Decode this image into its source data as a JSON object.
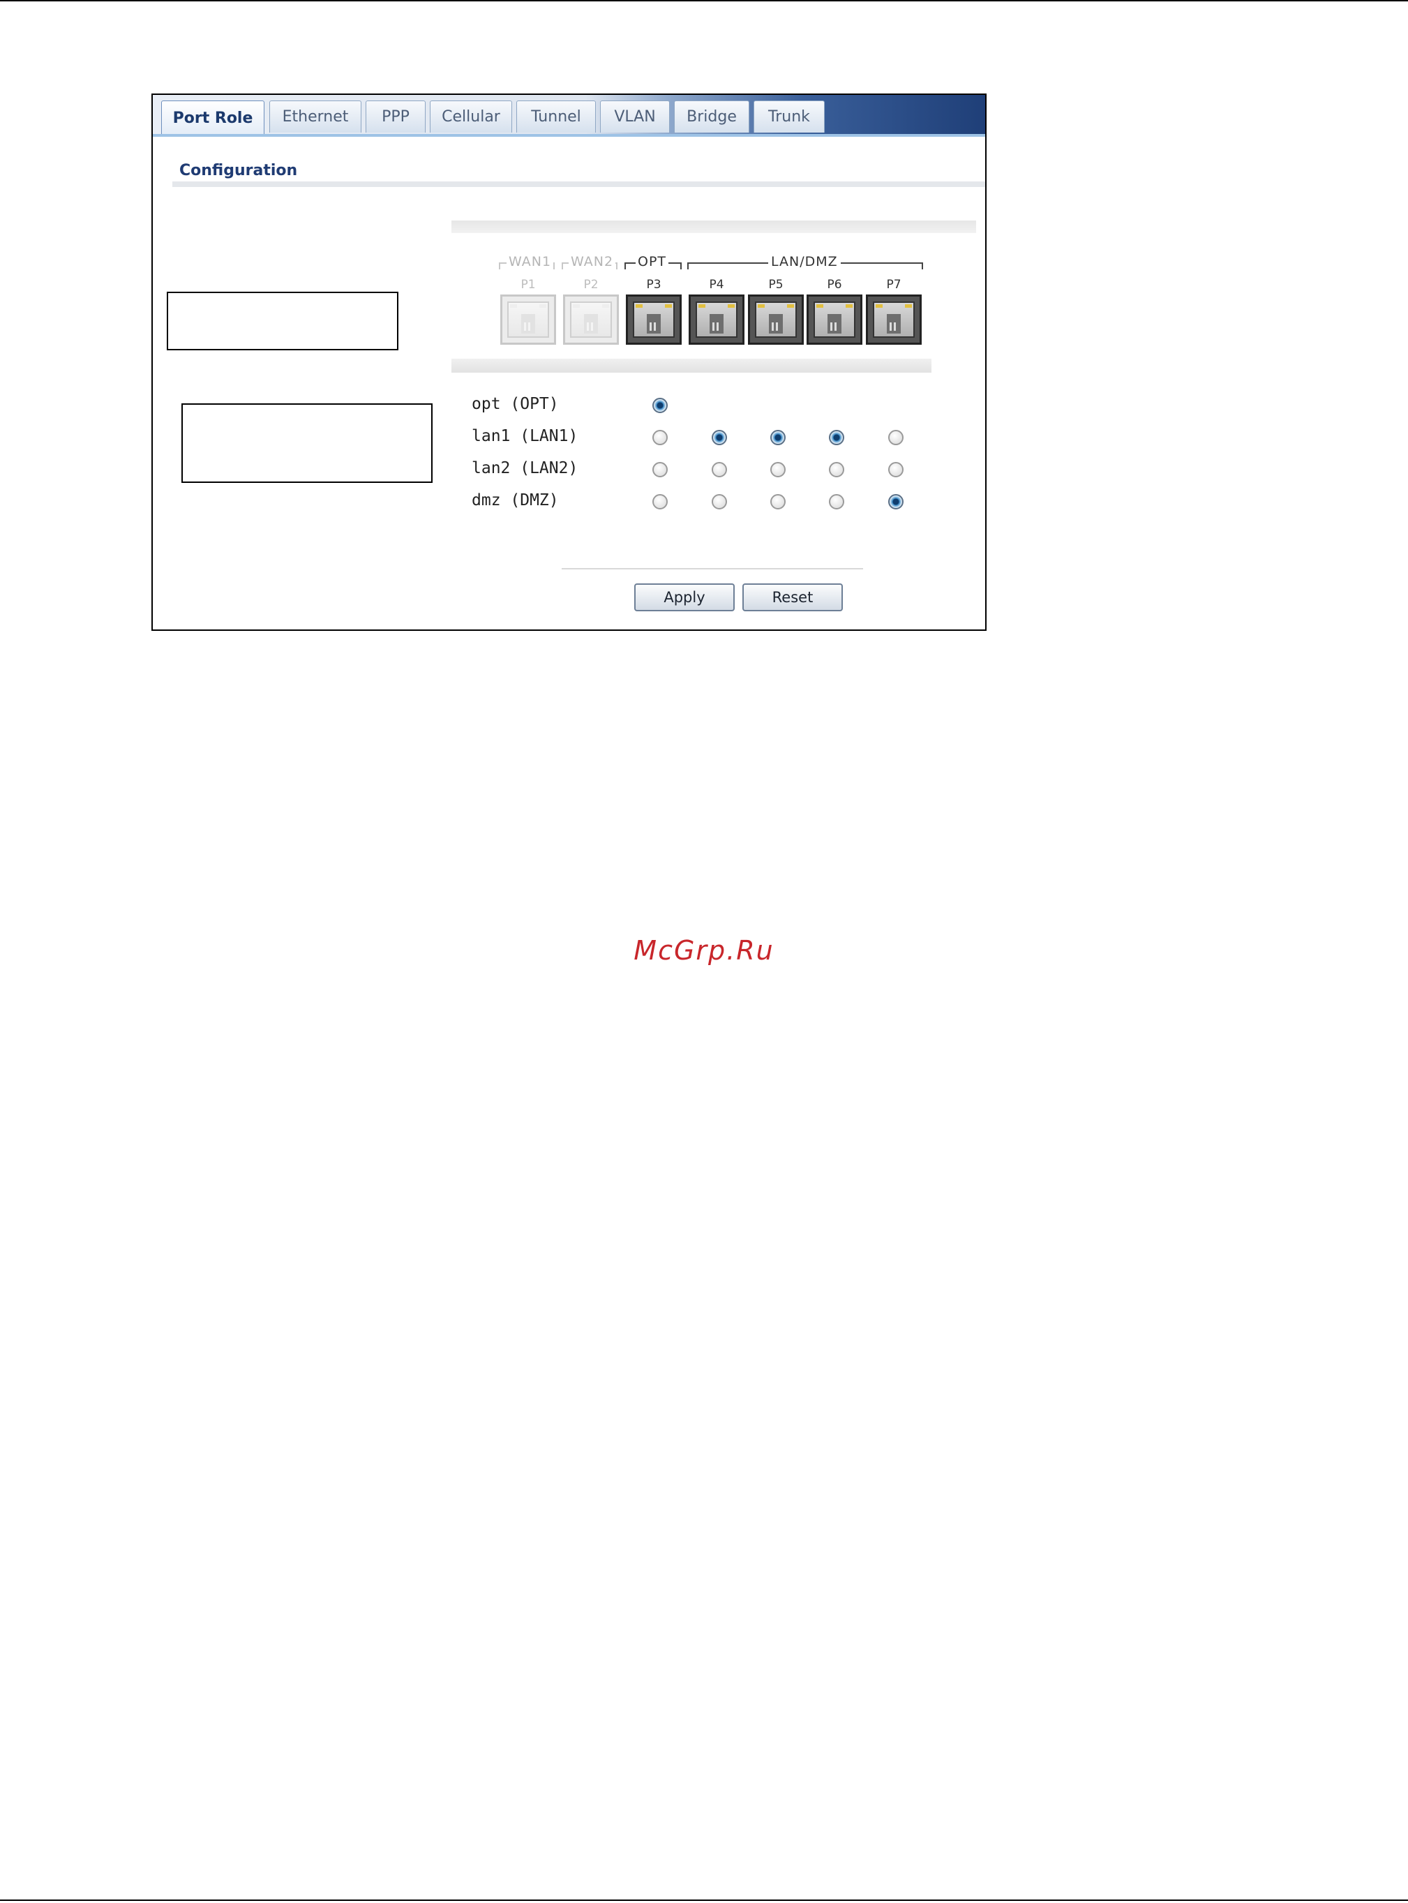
{
  "tabs": [
    {
      "label": "Port Role",
      "active": true
    },
    {
      "label": "Ethernet"
    },
    {
      "label": "PPP"
    },
    {
      "label": "Cellular"
    },
    {
      "label": "Tunnel"
    },
    {
      "label": "VLAN"
    },
    {
      "label": "Bridge"
    },
    {
      "label": "Trunk"
    }
  ],
  "section": {
    "title": "Configuration"
  },
  "port_groups": {
    "wan1": "WAN1",
    "wan2": "WAN2",
    "opt": "OPT",
    "lan_dmz": "LAN/DMZ"
  },
  "ports": [
    {
      "label": "P1",
      "enabled": false
    },
    {
      "label": "P2",
      "enabled": false
    },
    {
      "label": "P3",
      "enabled": true
    },
    {
      "label": "P4",
      "enabled": true
    },
    {
      "label": "P5",
      "enabled": true
    },
    {
      "label": "P6",
      "enabled": true
    },
    {
      "label": "P7",
      "enabled": true
    }
  ],
  "roles": [
    {
      "label": "opt (OPT)",
      "selected_ports": [
        "P3"
      ]
    },
    {
      "label": "lan1 (LAN1)",
      "selected_ports": [
        "P4",
        "P5",
        "P6"
      ]
    },
    {
      "label": "lan2 (LAN2)",
      "selected_ports": []
    },
    {
      "label": "dmz (DMZ)",
      "selected_ports": [
        "P7"
      ]
    }
  ],
  "buttons": {
    "apply": "Apply",
    "reset": "Reset"
  },
  "watermark": "McGrp.Ru"
}
